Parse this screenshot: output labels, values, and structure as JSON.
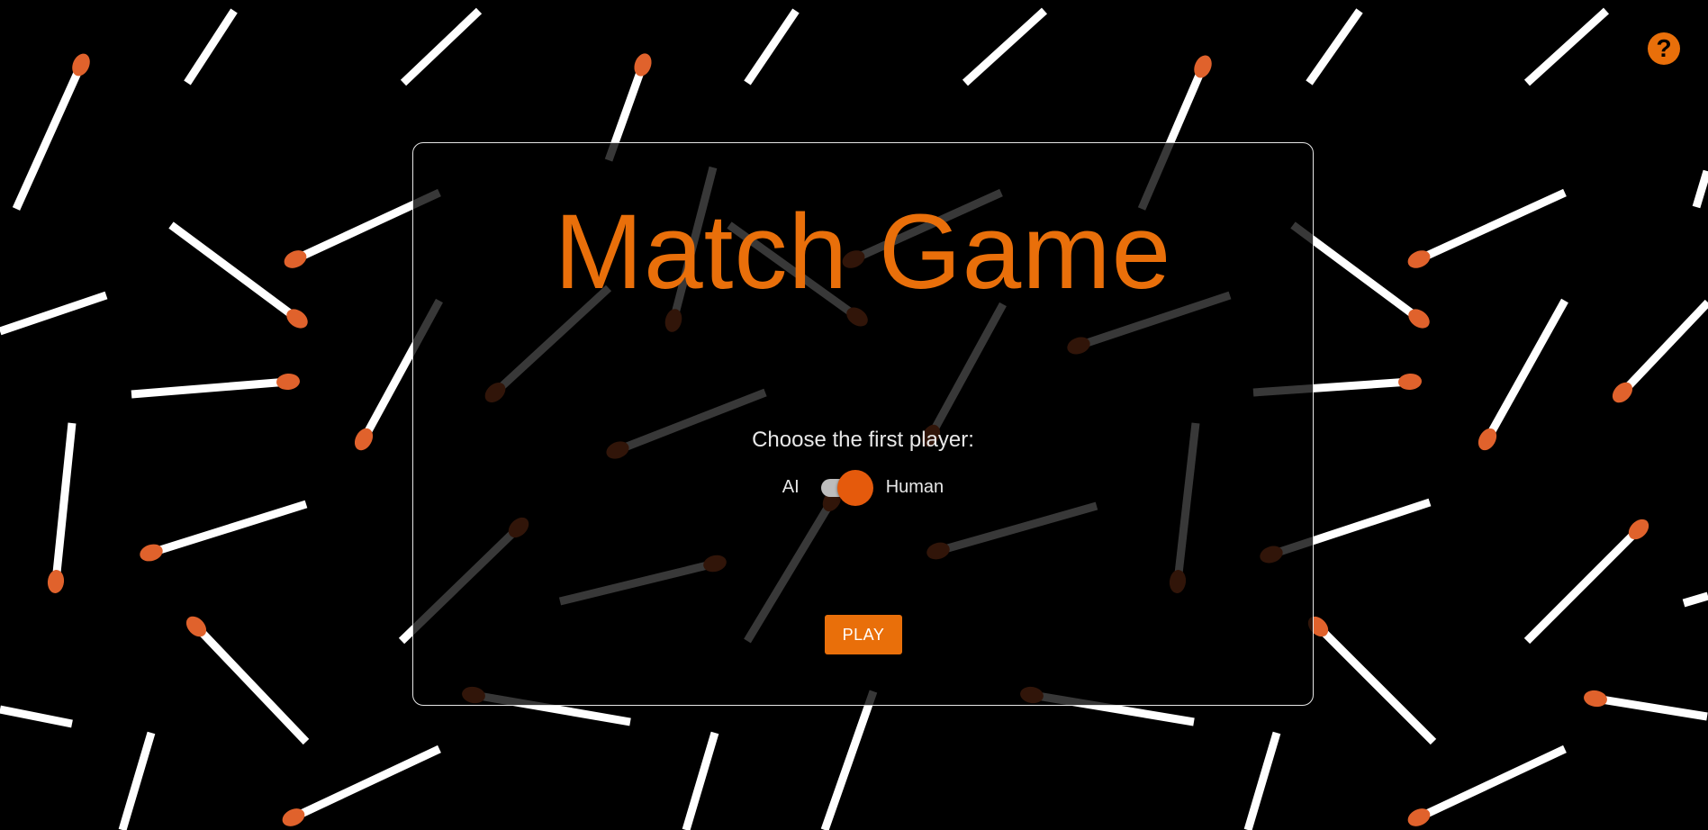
{
  "app": {
    "title": "Match Game",
    "help_symbol": "?",
    "accent_color": "#e96f0a",
    "toggle_thumb_color": "#e55a0c"
  },
  "setup": {
    "prompt": "Choose the first player:",
    "option_left": "AI",
    "option_right": "Human",
    "selected_first_player": "Human",
    "play_label": "PLAY"
  },
  "background": {
    "description_icon": "matchstick-pattern-icon",
    "stick_color": "#ffffff",
    "head_color": "#e0622c"
  }
}
